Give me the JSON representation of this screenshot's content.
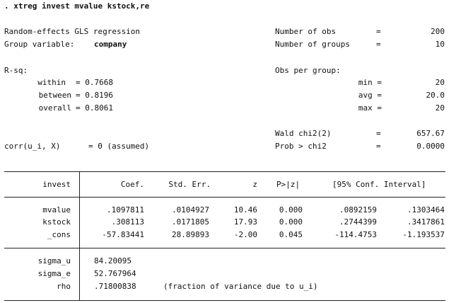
{
  "command": ". xtreg invest mvalue kstock,re",
  "header": {
    "model_title": "Random-effects GLS regression",
    "group_label": "Group variable:",
    "group_value": "company",
    "nobs_label": "Number of obs",
    "nobs_eq": "=",
    "nobs_value": "200",
    "ngroups_label": "Number of groups",
    "ngroups_eq": "=",
    "ngroups_value": "10",
    "rsq_label": "R-sq:",
    "within_label": "within",
    "within_value": "= 0.7668",
    "between_label": "between",
    "between_value": "= 0.8196",
    "overall_label": "overall",
    "overall_value": "= 0.8061",
    "obs_per_group_label": "Obs per group:",
    "min_label": "min =",
    "min_value": "20",
    "avg_label": "avg =",
    "avg_value": "20.0",
    "max_label": "max =",
    "max_value": "20",
    "wald_label": "Wald chi2(2)",
    "wald_eq": "=",
    "wald_value": "657.67",
    "prob_label": "Prob > chi2",
    "prob_eq": "=",
    "prob_value": "0.0000",
    "corr_label": "corr(u_i, X)",
    "corr_value": "= 0 (assumed)"
  },
  "table": {
    "columns": {
      "depvar": "invest",
      "coef": "Coef.",
      "se": "Std. Err.",
      "z": "z",
      "p": "P>|z|",
      "ci": "[95% Conf. Interval]"
    },
    "rows": [
      {
        "var": "mvalue",
        "coef": ".1097811",
        "se": ".0104927",
        "z": "10.46",
        "p": "0.000",
        "lo": ".0892159",
        "hi": ".1303464"
      },
      {
        "var": "kstock",
        "coef": ".308113",
        "se": ".0171805",
        "z": "17.93",
        "p": "0.000",
        "lo": ".2744399",
        "hi": ".3417861"
      },
      {
        "var": "_cons",
        "coef": "-57.83441",
        "se": "28.89893",
        "z": "-2.00",
        "p": "0.045",
        "lo": "-114.4753",
        "hi": "-1.193537"
      }
    ],
    "sigma_u_label": "sigma_u",
    "sigma_u_value": "84.20095",
    "sigma_e_label": "sigma_e",
    "sigma_e_value": "52.767964",
    "rho_label": "rho",
    "rho_value": ".71800838",
    "rho_note": "(fraction of variance due to u_i)"
  }
}
